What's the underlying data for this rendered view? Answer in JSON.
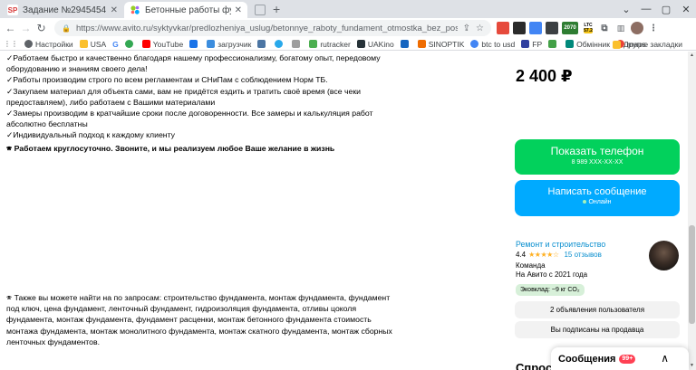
{
  "browser": {
    "tabs": [
      {
        "icon_text": "SP",
        "title": "Задание №2945454 - просмотр з",
        "active": false
      },
      {
        "icon_text": "",
        "title": "Бетонные работы фундамент отм",
        "active": true
      },
      {
        "icon_text": "",
        "title": "",
        "active": false
      }
    ],
    "new_tab": "+",
    "window_controls": [
      "⌄",
      "—",
      "▢",
      "✕"
    ],
    "url": "https://www.avito.ru/syktyvkar/predlozheniya_uslug/betonnye_raboty_fundament_otmostka_bez_posrednikov_75780583​87?co...",
    "ext_ltc": "LTC",
    "ext_ltc_value": "57.2",
    "ext_count": "2070",
    "bookmarks": [
      "Настройки",
      "USA",
      "G",
      "",
      "YouTube",
      "",
      "загрузчик",
      "VK",
      "",
      "",
      "rutracker",
      "UAKino",
      "",
      "SINOPTIK",
      "btc to usd",
      "FP",
      "",
      "Обмінник",
      "maps"
    ],
    "bookmarks_other": "Другие закладки"
  },
  "listing": {
    "description_lines": [
      "✓Работаем быстро и качественно благодаря нашему профессионализму, богатому опыт, передовому оборудованию и знаниям своего дела!",
      "✓Работы производим строго по всем регламентам и СНиПам с соблюдением Норм ТБ.",
      "✓Закупаем материал для объекта сами, вам не придётся ездить и тратить своё время (все чеки предоставляем), либо работаем с Вашими материалами",
      "✓Замеры производим в кратчайшие сроки после договоренности. Все замеры и калькуляция работ абсолютно бесплатны",
      "✓Индивидуальный подход к каждому клиенту"
    ],
    "callout": "🕾 Работаем круглосуточно. Звоните, и мы реализуем любое Ваше желание в жизнь",
    "search_text": "🕾 Также вы можете найти на по запросам: строительство фундамента, монтаж фундамента, фундамент под ключ, цена фундамент, ленточный фундамент, гидроизоляция фундамента, отливы цоколя фундамента, монтаж фундамента, фундамент расценки, монтаж бетонного фундамента стоимость монтажа фундамента, монтаж монолитного фундамента, монтаж скатного фундамента, монтаж сборных ленточных фундаментов.",
    "price": "2 400 ₽"
  },
  "actions": {
    "show_phone": "Показать телефон",
    "phone_mask": "8 989 XXX-XX-XX",
    "write_message": "Написать сообщение",
    "online_status": "Онлайн"
  },
  "seller": {
    "name": "Ремонт и строительство",
    "rating": "4.4",
    "stars": "★★★★☆",
    "reviews": "15 отзывов",
    "type": "Команда",
    "since": "На Авито с 2021 года",
    "eco_badge": "Эковклад: ~9 кг CO₂",
    "listings_button": "2 объявления пользователя",
    "subscribed_button": "Вы подписаны на продавца"
  },
  "next_heading": "Спрос",
  "messages": {
    "label": "Сообщения",
    "badge": "99+",
    "chevron": "∧"
  },
  "scrollbar": {
    "up": "▲",
    "down": "▼"
  },
  "colors": {
    "phone_button": "#02d15c",
    "message_button": "#00aaff",
    "link": "#0a8fcf",
    "badge": "#ff4053"
  }
}
